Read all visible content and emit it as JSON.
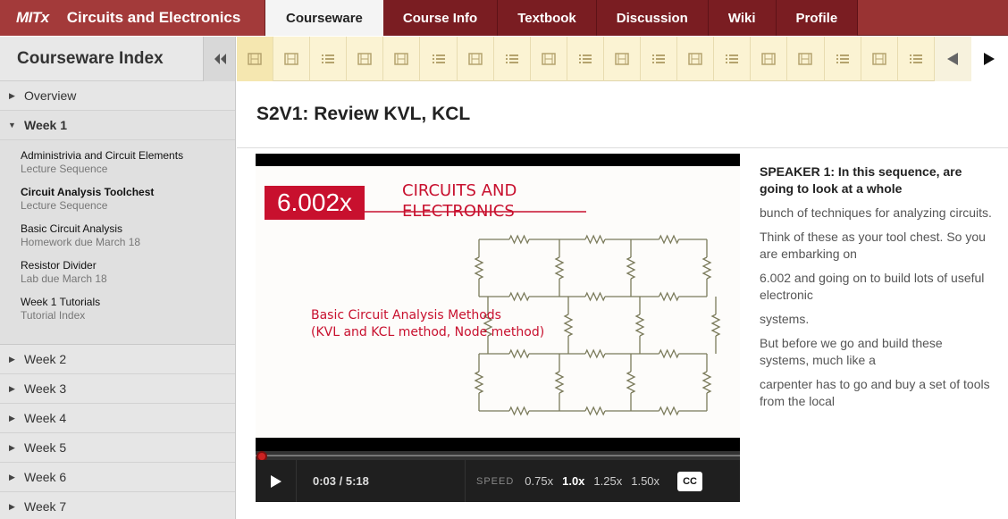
{
  "brand": {
    "logo": "MITx",
    "course": "Circuits and Electronics"
  },
  "tabs": [
    {
      "label": "Courseware",
      "active": true
    },
    {
      "label": "Course Info"
    },
    {
      "label": "Textbook"
    },
    {
      "label": "Discussion"
    },
    {
      "label": "Wiki"
    },
    {
      "label": "Profile"
    }
  ],
  "sidebar": {
    "title": "Courseware Index",
    "collapse_icon": "double-chevron-left-icon",
    "weeks": [
      {
        "label": "Overview"
      },
      {
        "label": "Week 1",
        "open": true
      },
      {
        "label": "Week 2"
      },
      {
        "label": "Week 3"
      },
      {
        "label": "Week 4"
      },
      {
        "label": "Week 5"
      },
      {
        "label": "Week 6"
      },
      {
        "label": "Week 7"
      }
    ],
    "week1_items": [
      {
        "title": "Administrivia and Circuit Elements",
        "subtitle": "Lecture Sequence"
      },
      {
        "title": "Circuit Analysis Toolchest",
        "subtitle": "Lecture Sequence",
        "current": true
      },
      {
        "title": "Basic Circuit Analysis",
        "subtitle": "Homework due March 18"
      },
      {
        "title": "Resistor Divider",
        "subtitle": "Lab due March 18"
      },
      {
        "title": "Week 1 Tutorials",
        "subtitle": "Tutorial Index"
      }
    ]
  },
  "sequence": {
    "items": [
      "video",
      "video",
      "list",
      "video",
      "video",
      "list",
      "video",
      "list",
      "video",
      "list",
      "video",
      "list",
      "video",
      "list",
      "video",
      "video",
      "list",
      "video",
      "list"
    ],
    "prev_icon": "triangle-left-icon",
    "next_icon": "triangle-right-icon"
  },
  "page": {
    "title": "S2V1: Review KVL, KCL"
  },
  "video": {
    "slide_label": "6.002x",
    "slide_title_1": "CIRCUITS AND",
    "slide_title_2": "ELECTRONICS",
    "slide_sub_1": "Basic Circuit Analysis Methods",
    "slide_sub_2": "(KVL and KCL method, Node method)",
    "time": "0:03 / 5:18",
    "progress": 0.01,
    "speed_label": "SPEED",
    "speeds": [
      "0.75x",
      "1.0x",
      "1.25x",
      "1.50x"
    ],
    "active_speed": "1.0x",
    "cc_label": "CC"
  },
  "transcript": [
    {
      "text": "SPEAKER 1: In this sequence, are going to look at a whole",
      "current": true
    },
    {
      "text": "bunch of techniques for analyzing circuits."
    },
    {
      "text": "Think of these as your tool chest. So you are embarking on"
    },
    {
      "text": "6.002 and going on to build lots of useful electronic"
    },
    {
      "text": "systems."
    },
    {
      "text": "But before we go and build these systems, much like a"
    },
    {
      "text": "carpenter has to go and buy a set of tools from the local"
    }
  ],
  "colors": {
    "brand": "#993333",
    "tab_dark": "#7a1d22",
    "slide_red": "#c8102e",
    "seq_bg": "#fbf3d3"
  }
}
